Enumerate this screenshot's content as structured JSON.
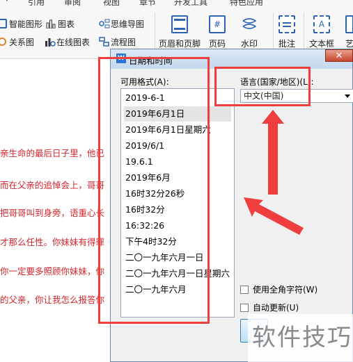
{
  "ribbon": {
    "tabs": [
      "·",
      "引用",
      "审阅",
      "视图",
      "章节",
      "开发工具",
      "特色应用"
    ],
    "smart_art": "智能图形",
    "chart": "图表",
    "mind_map": "思维导图",
    "relation": "关系图",
    "online_chart": "在线图表",
    "flowchart": "流程图",
    "header_footer": "页眉和页脚",
    "page_number": "页码",
    "watermark": "水印",
    "comment": "批注",
    "textbox": "文本框",
    "overflow": "艺"
  },
  "document": {
    "lines": [
      "亲生命的最后日子里，他已",
      "而在父亲的追悼会上，哥哥",
      "把哥哥叫到身旁，语重心长",
      "才那么任性。你妹妹有得罪",
      "你一定要多照顾你妹妹，你",
      "的父亲，你让我怎么报答你"
    ]
  },
  "dialog": {
    "title": "日期和时间",
    "close": "✕",
    "formats_label": "可用格式(A):",
    "formats": [
      "2019-6-1",
      "2019年6月1日",
      "2019年6月1日星期六",
      "2019/6/1",
      "19.6.1",
      "2019年6月",
      "16时32分26秒",
      "16时32分",
      "16:32:26",
      "下午4时32分",
      "二〇一九年六月一日",
      "二〇一九年六月一日星期六",
      "二〇一九年六月"
    ],
    "selected_index": 1,
    "language_label": "语言(国家/地区)(L):",
    "language_value": "中文(中国)",
    "fullwidth_label": "使用全角字符(W)",
    "autoupdate_label": "自动更新(U)"
  },
  "watermark_text": "软件技巧",
  "colors": {
    "doc_text": "#d3242a",
    "annotation": "#ef3e3e",
    "ribbon_icon": "#2d64b3"
  }
}
